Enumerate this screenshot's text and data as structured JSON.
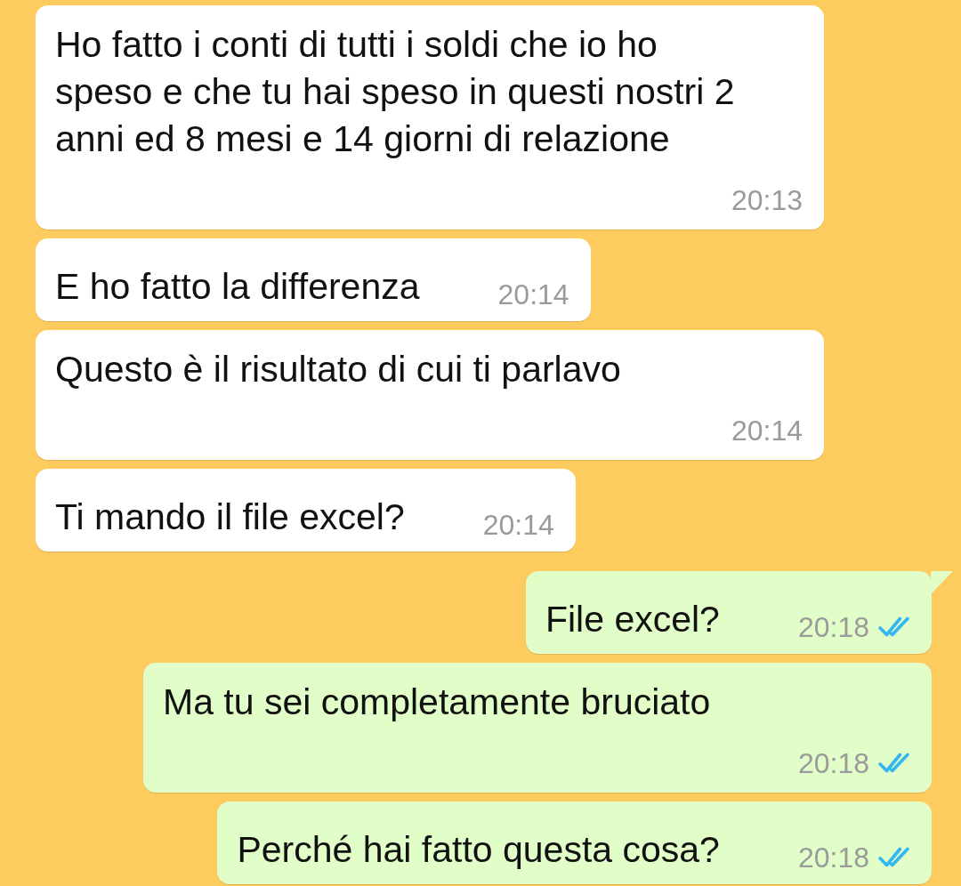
{
  "messages": [
    {
      "outgoing": false,
      "kind": "stacked",
      "text": "Ho fatto i conti di tutti i soldi che io ho speso e che tu hai speso in questi nostri 2 anni ed 8 mesi e 14 giorni di relazione",
      "time": "20:13"
    },
    {
      "outgoing": false,
      "kind": "inline",
      "text": "E ho fatto la differenza",
      "time": "20:14"
    },
    {
      "outgoing": false,
      "kind": "stacked",
      "text": "Questo è il risultato di cui ti parlavo",
      "time": "20:14"
    },
    {
      "outgoing": false,
      "kind": "inline",
      "text": "Ti mando il file excel?",
      "time": "20:14"
    },
    {
      "outgoing": true,
      "kind": "inline",
      "text": "File excel?",
      "time": "20:18",
      "read": true,
      "tail": true
    },
    {
      "outgoing": true,
      "kind": "stacked",
      "text": "Ma tu sei completamente bruciato",
      "time": "20:18",
      "read": true,
      "tail": false
    },
    {
      "outgoing": true,
      "kind": "inline",
      "text": "Perché hai fatto questa cosa?",
      "time": "20:18",
      "read": true,
      "tail": false
    }
  ]
}
